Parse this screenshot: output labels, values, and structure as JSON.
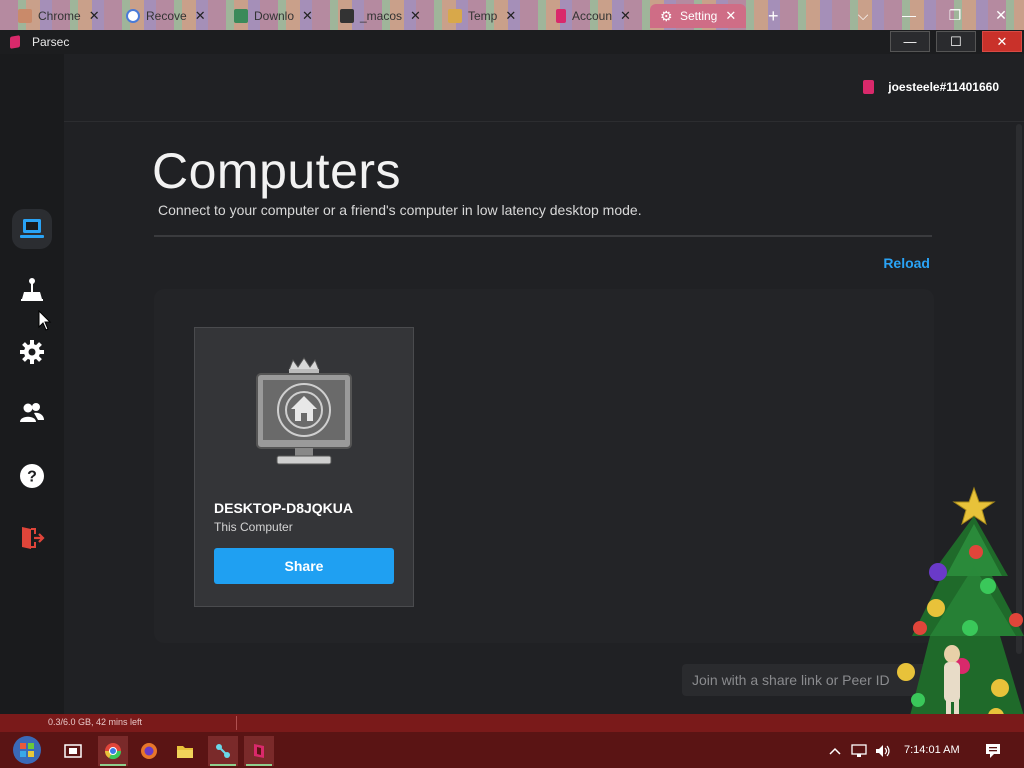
{
  "browser": {
    "tabs": [
      {
        "label": "Chrome",
        "icon": "chrome-tab-icon",
        "color": "#c98a6a"
      },
      {
        "label": "Recove",
        "icon": "google-icon",
        "color": "#4a7bd8"
      },
      {
        "label": "Downlo",
        "icon": "download-cloud-icon",
        "color": "#3a8a5a"
      },
      {
        "label": "_macos",
        "icon": "archive-icon",
        "color": "#333333"
      },
      {
        "label": "Temp",
        "icon": "envelope-icon",
        "color": "#d8a84a"
      },
      {
        "label": "Accoun",
        "icon": "parsec-icon",
        "color": "#d9296b"
      },
      {
        "label": "Setting",
        "icon": "gear-icon",
        "color": "#ffffff"
      }
    ],
    "new_tab": "+",
    "controls": {
      "dropdown": "⌵",
      "minimize": "—",
      "restore": "❐",
      "close": "✕"
    }
  },
  "window": {
    "title": "Parsec",
    "controls": {
      "minimize": "—",
      "maximize": "☐",
      "close": "✕"
    }
  },
  "user": {
    "name": "joesteele#11401660"
  },
  "sidebar": {
    "items": [
      {
        "name": "computers",
        "icon": "laptop-icon",
        "active": true
      },
      {
        "name": "arcade",
        "icon": "joystick-icon",
        "active": false
      },
      {
        "name": "settings",
        "icon": "gear-icon",
        "active": false
      },
      {
        "name": "friends",
        "icon": "users-icon",
        "active": false
      },
      {
        "name": "help",
        "icon": "help-icon",
        "active": false
      },
      {
        "name": "logout",
        "icon": "logout-icon",
        "active": false
      }
    ]
  },
  "page": {
    "title": "Computers",
    "subtitle": "Connect to your computer or a friend's computer in low latency desktop mode.",
    "reload": "Reload"
  },
  "computer": {
    "name": "DESKTOP-D8JQKUA",
    "subtitle": "This Computer",
    "share_label": "Share"
  },
  "join": {
    "placeholder": "Join with a share link or Peer ID"
  },
  "status": {
    "text": "0.3/6.0 GB, 42 mins left"
  },
  "taskbar": {
    "time": "7:14:01 AM",
    "apps": [
      "start-button",
      "task-view",
      "chrome",
      "firefox",
      "file-explorer",
      "network-app",
      "parsec"
    ]
  },
  "colors": {
    "accent": "#1fa0f2",
    "brand": "#d9296b",
    "danger": "#e0453a"
  }
}
